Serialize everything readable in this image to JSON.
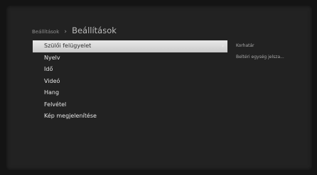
{
  "breadcrumb": {
    "parent": "Beállítások",
    "separator": "›",
    "current": "Beállítások"
  },
  "menu": {
    "items": [
      {
        "label": "Szülői felügyelet",
        "selected": true
      },
      {
        "label": "Nyelv"
      },
      {
        "label": "Idő"
      },
      {
        "label": "Videó"
      },
      {
        "label": "Hang"
      },
      {
        "label": "Felvétel"
      },
      {
        "label": "Kép megjelenítése"
      }
    ],
    "arrow_icon": "›"
  },
  "submenu": {
    "items": [
      {
        "label": "Korhatár"
      },
      {
        "label": "Beltéri egység jelsza..."
      }
    ]
  }
}
